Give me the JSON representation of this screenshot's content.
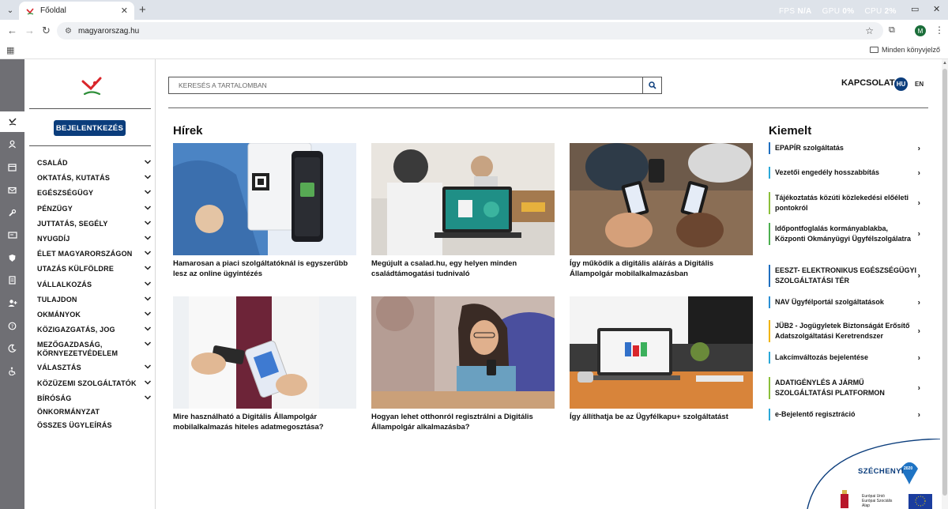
{
  "browser": {
    "tab_title": "Főoldal",
    "url": "magyarorszag.hu",
    "bookmarks_all": "Minden könyvjelző",
    "profile_initial": "M",
    "perf": [
      {
        "label": "FPS",
        "value": "N/A"
      },
      {
        "label": "GPU",
        "value": "0%"
      },
      {
        "label": "CPU",
        "value": "2%"
      }
    ]
  },
  "sidebar": {
    "login_label": "BEJELENTKEZÉS",
    "menu": [
      {
        "label": "CSALÁD",
        "expandable": true
      },
      {
        "label": "OKTATÁS, KUTATÁS",
        "expandable": true
      },
      {
        "label": "EGÉSZSÉGÜGY",
        "expandable": true
      },
      {
        "label": "PÉNZÜGY",
        "expandable": true
      },
      {
        "label": "JUTTATÁS, SEGÉLY",
        "expandable": true
      },
      {
        "label": "NYUGDÍJ",
        "expandable": true
      },
      {
        "label": "ÉLET MAGYARORSZÁGON",
        "expandable": true
      },
      {
        "label": "UTAZÁS KÜLFÖLDRE",
        "expandable": true
      },
      {
        "label": "VÁLLALKOZÁS",
        "expandable": true
      },
      {
        "label": "TULAJDON",
        "expandable": true
      },
      {
        "label": "OKMÁNYOK",
        "expandable": true
      },
      {
        "label": "KÖZIGAZGATÁS, JOG",
        "expandable": true
      },
      {
        "label": "MEZŐGAZDASÁG, KÖRNYEZETVÉDELEM",
        "expandable": true
      },
      {
        "label": "VÁLASZTÁS",
        "expandable": true
      },
      {
        "label": "KÖZÜZEMI SZOLGÁLTATÓK",
        "expandable": true
      },
      {
        "label": "BÍRÓSÁG",
        "expandable": true
      },
      {
        "label": "ÖNKORMÁNYZAT",
        "expandable": false
      },
      {
        "label": "ÖSSZES ÜGYLEÍRÁS",
        "expandable": false
      }
    ]
  },
  "header": {
    "search_placeholder": "KERESÉS A TARTALOMBAN",
    "contact_label": "KAPCSOLAT",
    "lang_active": "HU",
    "lang_other": "EN"
  },
  "news": {
    "heading": "Hírek",
    "items": [
      {
        "title": "Hamarosan a piaci szolgáltatóknál is egyszerűbb lesz az online ügyintézés",
        "image": "phone-qr"
      },
      {
        "title": "Megújult a csalad.hu, egy helyen minden családtámogatási tudnivaló",
        "image": "laptop-family"
      },
      {
        "title": "Így működik a digitális aláírás a Digitális Állampolgár mobilalkalmazásban",
        "image": "phones-hands"
      },
      {
        "title": "Mire használható a Digitális Állampolgár mobilalkalmazás hiteles adatmegosztása?",
        "image": "doctor-phone"
      },
      {
        "title": "Hogyan lehet otthonról regisztrálni a Digitális Állampolgár alkalmazásba?",
        "image": "woman-phone"
      },
      {
        "title": "Így állíthatja be az Ügyfélkapu+ szolgáltatást",
        "image": "laptop-desk"
      }
    ]
  },
  "featured": {
    "heading": "Kiemelt",
    "items": [
      {
        "label": "EPAPÍR szolgáltatás",
        "color": "#1f6fbf"
      },
      {
        "label": "Vezetői engedély hosszabbítás",
        "color": "#2aa8d8"
      },
      {
        "label": "Tájékoztatás közúti közlekedési előéleti pontokról",
        "color": "#8bbf3a"
      },
      {
        "label": "Időpontfoglalás kormányablakba, Központi Okmányügyi Ügyfélszolgálatra",
        "color": "#4caf50"
      },
      {
        "label": "EESZT- ELEKTRONIKUS EGÉSZSÉGÜGYI SZOLGÁLTATÁSI TÉR",
        "color": "#1f6fbf"
      },
      {
        "label": "NAV Ügyfélportál szolgáltatások",
        "color": "#2a8fd4"
      },
      {
        "label": "JÜB2 - Jogügyletek Biztonságát Erősítő Adatszolgáltatási Keretrendszer",
        "color": "#f0b400"
      },
      {
        "label": "Lakcímváltozás bejelentése",
        "color": "#2aa8d8"
      },
      {
        "label": "ADATIGÉNYLÉS A JÁRMŰ SZOLGÁLTATÁSI PLATFORMON",
        "color": "#8bbf3a"
      },
      {
        "label": "e-Bejelentő regisztráció",
        "color": "#2aa8d8"
      }
    ]
  },
  "footer_badge": {
    "title": "SZÉCHENYI",
    "year": "2020",
    "eu_line1": "Európai Unió",
    "eu_line2": "Európai Szociális",
    "eu_line3": "Alap"
  },
  "colors": {
    "brand_blue": "#0b3d7c",
    "rail": "#6f6f74",
    "accent": "#2a8fd4"
  }
}
